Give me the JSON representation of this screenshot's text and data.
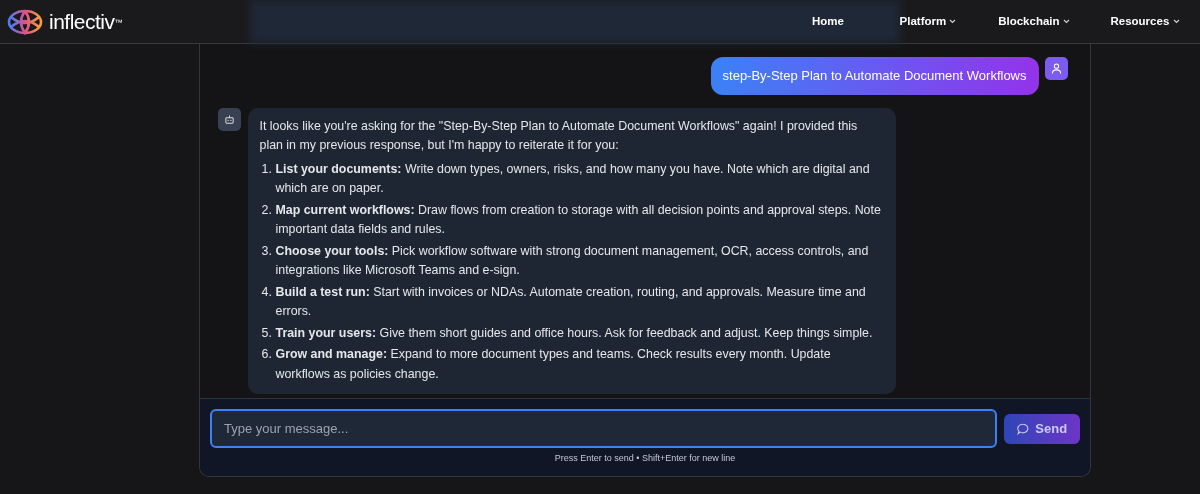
{
  "brand": {
    "name": "inflectiv",
    "mark": "™"
  },
  "nav": [
    {
      "label": "Home",
      "dropdown": false
    },
    {
      "label": "Platform",
      "dropdown": true
    },
    {
      "label": "Blockchain",
      "dropdown": true
    },
    {
      "label": "Resources",
      "dropdown": true
    }
  ],
  "messages": [
    {
      "kind": "user",
      "text": "step-By-Step Plan to Automate Document Workflows"
    },
    {
      "kind": "assistant",
      "intro": "It looks like you're asking for the \"Step-By-Step Plan to Automate Document Workflows\" again! I provided this plan in my previous response, but I'm happy to reiterate it for you:",
      "steps": [
        {
          "number": "1.",
          "text": "**List your documents:** Write down types, owners, risks, and how many you have. Note which are digital and which are on paper."
        },
        {
          "number": "2.",
          "text": "**Map current workflows:** Draw flows from creation to storage with all decision points and approval steps. Note important data fields and rules."
        },
        {
          "number": "3.",
          "text": "**Choose your tools:** Pick workflow software with strong document management, OCR, access controls, and integrations like Microsoft Teams and e-sign."
        },
        {
          "number": "4.",
          "text": "**Build a test run:** Start with invoices or NDAs. Automate creation, routing, and approvals. Measure time and errors."
        },
        {
          "number": "5.",
          "text": "**Train your users:** Give them short guides and office hours. Ask for feedback and adjust. Keep things simple."
        },
        {
          "number": "6.",
          "text": "**Grow and manage:** Expand to more document types and teams. Check results every month. Update workflows as policies change."
        }
      ]
    }
  ],
  "composer": {
    "placeholder": "Type your message...",
    "send": "Send",
    "hint": "Press Enter to send • Shift+Enter for new line"
  }
}
